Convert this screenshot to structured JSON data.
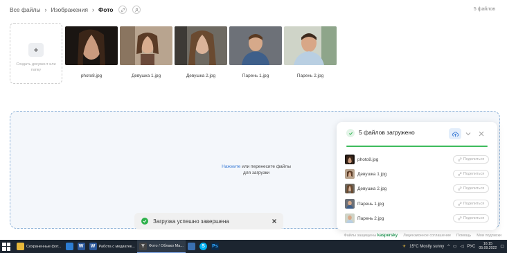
{
  "breadcrumb": {
    "root": "Все файлы",
    "parent": "Изображения",
    "current": "Фото"
  },
  "file_count": "5 файлов",
  "create_tile": {
    "plus": "+",
    "label": "Создать документ или папку"
  },
  "thumbnails": [
    {
      "name": "photo8.jpg"
    },
    {
      "name": "Девушка 1.jpg"
    },
    {
      "name": "Девушка 2.jpg"
    },
    {
      "name": "Парень 1.jpg"
    },
    {
      "name": "Парень 2.jpg"
    }
  ],
  "upload_zone": {
    "link": "Нажмите",
    "hint_rest": " или перенесите файлы для загрузки"
  },
  "panel": {
    "title": "5 файлов загружено",
    "progress": 1.0,
    "share_label": "Поделиться",
    "files": [
      {
        "name": "photo8.jpg"
      },
      {
        "name": "Девушка 1.jpg"
      },
      {
        "name": "Девушка 2.jpg"
      },
      {
        "name": "Парень 1.jpg"
      },
      {
        "name": "Парень 2.jpg"
      }
    ]
  },
  "toast": {
    "message": "Загрузка успешно завершена"
  },
  "footer": {
    "protected": "Файлы защищены",
    "brand": "kaspersky",
    "license": "Лицензионное соглашение",
    "help": "Помощь",
    "subscriptions": "Мои подписки"
  },
  "taskbar": {
    "items": [
      {
        "label": "Сохраненные фот..."
      },
      {
        "label": "Работа с медиатек..."
      },
      {
        "label": "Фото / Облако Ма..."
      }
    ],
    "weather": "15°C  Mostly sunny",
    "lang": "РУС",
    "time": "16:15",
    "date": "05.09.2022"
  },
  "colors": {
    "accent": "#3a7bd5",
    "success": "#2fb14c",
    "brand": "#2e9a5c"
  }
}
